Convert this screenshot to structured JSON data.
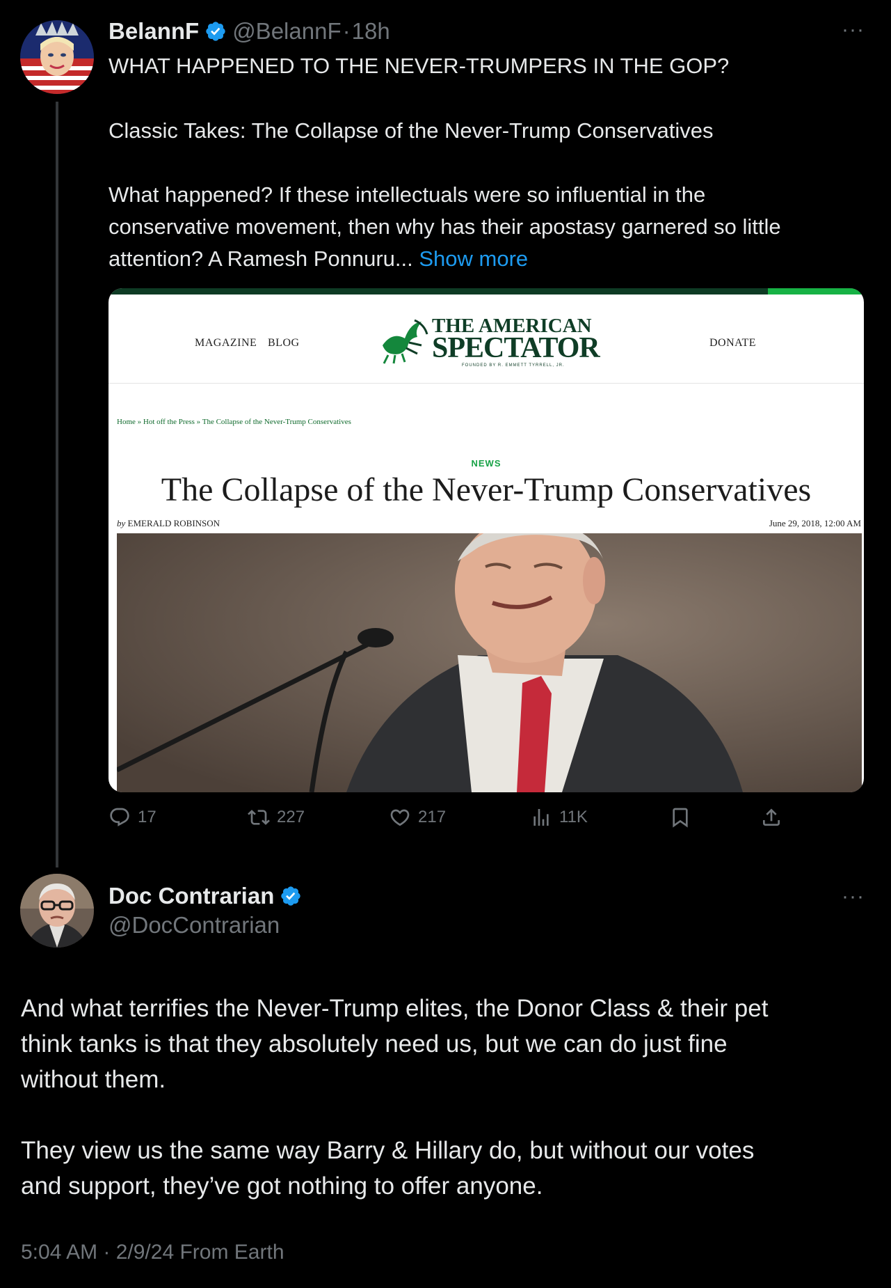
{
  "tweet1": {
    "author_name": "BelannF",
    "handle": "@BelannF",
    "separator": "·",
    "age": "18h",
    "more": "···",
    "line1": "WHAT HAPPENED TO THE NEVER-TRUMPERS IN THE GOP?",
    "line2": "Classic Takes: The Collapse of the Never-Trump Conservatives",
    "line3": "What happened? If these intellectuals were so influential in the",
    "line4": "conservative movement, then why has their apostasy garnered so little",
    "line5": "attention? A Ramesh Ponnuru...",
    "show_more": "Show more",
    "card": {
      "nav_magazine": "MAGAZINE",
      "nav_blog": "BLOG",
      "nav_donate": "DONATE",
      "logo_line1": "THE AMERICAN",
      "logo_line2": "SPECTATOR",
      "logo_tagline": "FOUNDED BY R. EMMETT TYRRELL, JR.",
      "breadcrumb": "Home » Hot off the Press » The Collapse of the Never-Trump Conservatives",
      "section": "NEWS",
      "headline": "The Collapse of the Never-Trump Conservatives",
      "byline_by": "by",
      "byline_name": "EMERALD ROBINSON",
      "date": "June 29, 2018, 12:00 AM"
    },
    "stats": {
      "replies": "17",
      "reposts": "227",
      "likes": "217",
      "views": "11K"
    }
  },
  "tweet2": {
    "author_name": "Doc Contrarian",
    "handle": "@DocContrarian",
    "more": "···",
    "para1_line1": "And what terrifies the Never-Trump elites, the Donor Class & their pet",
    "para1_line2": "think tanks is that they absolutely need us, but we can do just fine",
    "para1_line3": "without them.",
    "para2_line1": "They view us the same way Barry & Hillary do, but without our votes",
    "para2_line2": "and support, they’ve got nothing to offer anyone.",
    "timestamp": "5:04 AM · 2/9/24 From Earth"
  },
  "colors": {
    "background": "#000000",
    "text": "#e7e9ea",
    "muted": "#71767b",
    "link": "#1d9bf0",
    "verified": "#1d9bf0"
  }
}
